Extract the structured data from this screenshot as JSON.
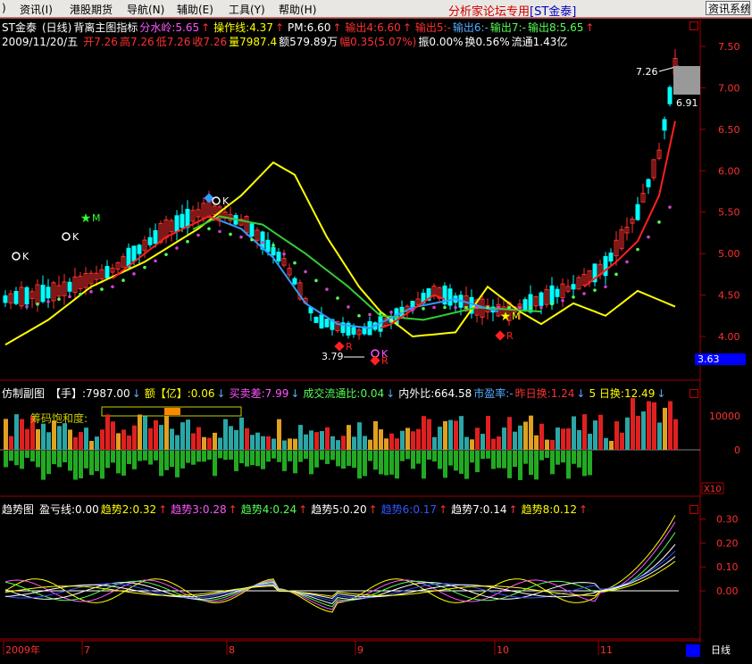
{
  "menu": {
    "items": [
      ")",
      "资讯(I)",
      "港股期货",
      "导航(N)",
      "辅助(E)",
      "工具(Y)",
      "帮助(H)"
    ],
    "brand": "分析家论坛专用",
    "brand_symbol": "[ST金泰]",
    "info_button": "资讯系统"
  },
  "header": {
    "line1": [
      {
        "text": "ST金泰",
        "color": "#ffffff"
      },
      {
        "text": "(日线)",
        "color": "#ffffff"
      },
      {
        "text": "背离主图指标",
        "color": "#ffffff"
      },
      {
        "text": "分水岭:5.65",
        "color": "#ff55ff"
      },
      {
        "text": "↑",
        "color": "#ff3030"
      },
      {
        "text": "操作线:4.37",
        "color": "#ffff00"
      },
      {
        "text": "↑",
        "color": "#ff3030"
      },
      {
        "text": "PM:6.60",
        "color": "#ffffff"
      },
      {
        "text": "↑",
        "color": "#ff3030"
      },
      {
        "text": "输出4:6.60",
        "color": "#ff3030"
      },
      {
        "text": "↑",
        "color": "#ff3030"
      },
      {
        "text": "输出5:-",
        "color": "#ff3030"
      },
      {
        "text": "输出6:-",
        "color": "#55aaff"
      },
      {
        "text": "输出7:-",
        "color": "#55ff55"
      },
      {
        "text": "输出8:5.65",
        "color": "#55ff55"
      },
      {
        "text": "↑",
        "color": "#ff3030"
      }
    ],
    "line2": [
      {
        "text": "2009/11/20/五",
        "color": "#ffffff"
      },
      {
        "text": "开7.26",
        "color": "#ff3030"
      },
      {
        "text": "高7.26",
        "color": "#ff3030"
      },
      {
        "text": "低7.26",
        "color": "#ff3030"
      },
      {
        "text": "收7.26",
        "color": "#ff3030"
      },
      {
        "text": "量7987.4",
        "color": "#ffff00"
      },
      {
        "text": "额579.89万",
        "color": "#ffffff"
      },
      {
        "text": "幅0.35(5.07%)",
        "color": "#ff3030"
      },
      {
        "text": "振0.00%",
        "color": "#ffffff"
      },
      {
        "text": "换0.56%",
        "color": "#ffffff"
      },
      {
        "text": "流通1.43亿",
        "color": "#ffffff"
      }
    ]
  },
  "price_axis": [
    "7.50",
    "7.00",
    "6.50",
    "6.00",
    "5.50",
    "5.00",
    "4.50",
    "4.00"
  ],
  "current_price": "3.63",
  "annotations": {
    "high_label": "7.26",
    "low_label": "6.91",
    "bottom_label": "3.79"
  },
  "signal_marks": {
    "buy": "K",
    "sell": "R",
    "star": "M"
  },
  "sub1": {
    "items": [
      {
        "text": "仿制副图",
        "color": "#ffffff"
      },
      {
        "text": "【手】:7987.00",
        "color": "#ffffff"
      },
      {
        "text": "↓",
        "color": "#55aaff"
      },
      {
        "text": "额【亿】:0.06",
        "color": "#ffff00"
      },
      {
        "text": "↓",
        "color": "#55aaff"
      },
      {
        "text": "买卖差:7.99",
        "color": "#ff55ff"
      },
      {
        "text": "↓",
        "color": "#55aaff"
      },
      {
        "text": "成交流通比:0.04",
        "color": "#55ff55"
      },
      {
        "text": "↓",
        "color": "#55aaff"
      },
      {
        "text": "内外比:664.58",
        "color": "#ffffff"
      },
      {
        "text": "市盈率:-",
        "color": "#55aaff"
      },
      {
        "text": "昨日换:1.24",
        "color": "#ff3030"
      },
      {
        "text": "↓",
        "color": "#55aaff"
      },
      {
        "text": "5 日换:12.49",
        "color": "#ffff00"
      },
      {
        "text": "↓",
        "color": "#55aaff"
      }
    ],
    "saturation_label": "筹码饱和度:",
    "axis": [
      "10000",
      "0"
    ],
    "scale": "X10"
  },
  "sub2": {
    "items": [
      {
        "text": "趋势图",
        "color": "#ffffff"
      },
      {
        "text": "盈亏线:0.00",
        "color": "#ffffff"
      },
      {
        "text": "趋势2:0.32",
        "color": "#ffff00"
      },
      {
        "text": "↑",
        "color": "#ff3030"
      },
      {
        "text": "趋势3:0.28",
        "color": "#ff55ff"
      },
      {
        "text": "↑",
        "color": "#ff3030"
      },
      {
        "text": "趋势4:0.24",
        "color": "#55ff55"
      },
      {
        "text": "↑",
        "color": "#ff3030"
      },
      {
        "text": "趋势5:0.20",
        "color": "#ffffff"
      },
      {
        "text": "↑",
        "color": "#ff3030"
      },
      {
        "text": "趋势6:0.17",
        "color": "#3355ff"
      },
      {
        "text": "↑",
        "color": "#ff3030"
      },
      {
        "text": "趋势7:0.14",
        "color": "#ffffff"
      },
      {
        "text": "↑",
        "color": "#ff3030"
      },
      {
        "text": "趋势8:0.12",
        "color": "#ffff00"
      },
      {
        "text": "↑",
        "color": "#ff3030"
      }
    ],
    "axis": [
      "0.30",
      "0.20",
      "0.10",
      "0.00"
    ]
  },
  "time_axis": {
    "labels": [
      "2009年",
      "7",
      "8",
      "9",
      "10",
      "11"
    ],
    "period_button": "日线"
  },
  "colors": {
    "grid": "#a00000",
    "up": "#ff3030",
    "down": "#00ffff",
    "watershed": "#ffff00",
    "ma_green": "#33cc33",
    "ma_blue": "#3399ff",
    "ma_red": "#ff2020",
    "ma_dots": "#cc44cc",
    "current_price_bg": "#0000ff"
  }
}
